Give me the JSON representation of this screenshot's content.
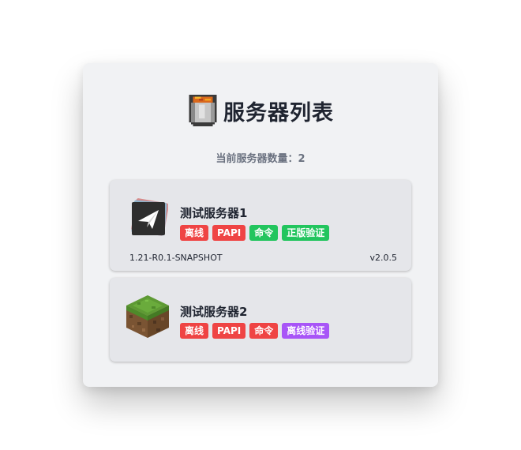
{
  "page": {
    "title": "服务器列表",
    "title_icon": "lava-bucket-icon"
  },
  "count": {
    "text": "当前服务器数量：2"
  },
  "colors": {
    "red": "#ef4444",
    "green": "#22c55e",
    "purple": "#a855f7"
  },
  "servers": [
    {
      "name": "测试服务器1",
      "icon": "paper-plane-icon",
      "tags": [
        {
          "label": "离线",
          "color": "#ef4444"
        },
        {
          "label": "PAPI",
          "color": "#ef4444"
        },
        {
          "label": "命令",
          "color": "#22c55e"
        },
        {
          "label": "正版验证",
          "color": "#22c55e"
        }
      ],
      "version": "1.21-R0.1-SNAPSHOT",
      "plugin_version": "v2.0.5"
    },
    {
      "name": "测试服务器2",
      "icon": "grass-block-icon",
      "tags": [
        {
          "label": "离线",
          "color": "#ef4444"
        },
        {
          "label": "PAPI",
          "color": "#ef4444"
        },
        {
          "label": "命令",
          "color": "#ef4444"
        },
        {
          "label": "离线验证",
          "color": "#a855f7"
        }
      ]
    }
  ]
}
